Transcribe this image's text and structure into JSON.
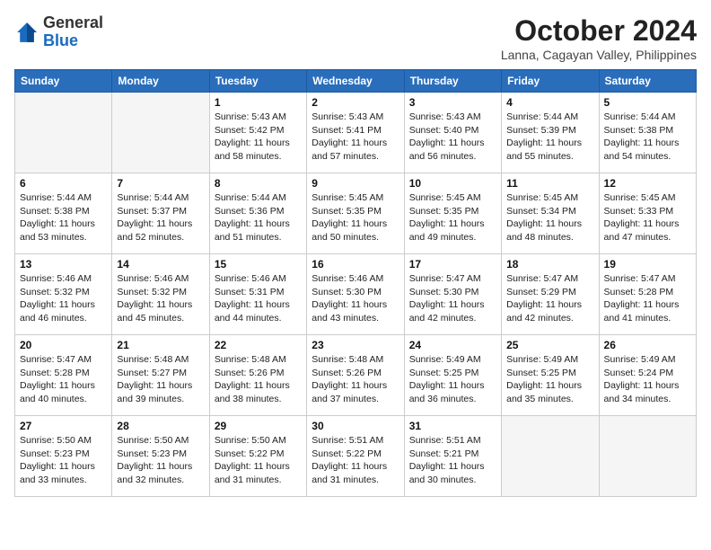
{
  "header": {
    "logo_general": "General",
    "logo_blue": "Blue",
    "month_title": "October 2024",
    "location": "Lanna, Cagayan Valley, Philippines"
  },
  "weekdays": [
    "Sunday",
    "Monday",
    "Tuesday",
    "Wednesday",
    "Thursday",
    "Friday",
    "Saturday"
  ],
  "weeks": [
    [
      {
        "day": "",
        "info": ""
      },
      {
        "day": "",
        "info": ""
      },
      {
        "day": "1",
        "info": "Sunrise: 5:43 AM\nSunset: 5:42 PM\nDaylight: 11 hours and 58 minutes."
      },
      {
        "day": "2",
        "info": "Sunrise: 5:43 AM\nSunset: 5:41 PM\nDaylight: 11 hours and 57 minutes."
      },
      {
        "day": "3",
        "info": "Sunrise: 5:43 AM\nSunset: 5:40 PM\nDaylight: 11 hours and 56 minutes."
      },
      {
        "day": "4",
        "info": "Sunrise: 5:44 AM\nSunset: 5:39 PM\nDaylight: 11 hours and 55 minutes."
      },
      {
        "day": "5",
        "info": "Sunrise: 5:44 AM\nSunset: 5:38 PM\nDaylight: 11 hours and 54 minutes."
      }
    ],
    [
      {
        "day": "6",
        "info": "Sunrise: 5:44 AM\nSunset: 5:38 PM\nDaylight: 11 hours and 53 minutes."
      },
      {
        "day": "7",
        "info": "Sunrise: 5:44 AM\nSunset: 5:37 PM\nDaylight: 11 hours and 52 minutes."
      },
      {
        "day": "8",
        "info": "Sunrise: 5:44 AM\nSunset: 5:36 PM\nDaylight: 11 hours and 51 minutes."
      },
      {
        "day": "9",
        "info": "Sunrise: 5:45 AM\nSunset: 5:35 PM\nDaylight: 11 hours and 50 minutes."
      },
      {
        "day": "10",
        "info": "Sunrise: 5:45 AM\nSunset: 5:35 PM\nDaylight: 11 hours and 49 minutes."
      },
      {
        "day": "11",
        "info": "Sunrise: 5:45 AM\nSunset: 5:34 PM\nDaylight: 11 hours and 48 minutes."
      },
      {
        "day": "12",
        "info": "Sunrise: 5:45 AM\nSunset: 5:33 PM\nDaylight: 11 hours and 47 minutes."
      }
    ],
    [
      {
        "day": "13",
        "info": "Sunrise: 5:46 AM\nSunset: 5:32 PM\nDaylight: 11 hours and 46 minutes."
      },
      {
        "day": "14",
        "info": "Sunrise: 5:46 AM\nSunset: 5:32 PM\nDaylight: 11 hours and 45 minutes."
      },
      {
        "day": "15",
        "info": "Sunrise: 5:46 AM\nSunset: 5:31 PM\nDaylight: 11 hours and 44 minutes."
      },
      {
        "day": "16",
        "info": "Sunrise: 5:46 AM\nSunset: 5:30 PM\nDaylight: 11 hours and 43 minutes."
      },
      {
        "day": "17",
        "info": "Sunrise: 5:47 AM\nSunset: 5:30 PM\nDaylight: 11 hours and 42 minutes."
      },
      {
        "day": "18",
        "info": "Sunrise: 5:47 AM\nSunset: 5:29 PM\nDaylight: 11 hours and 42 minutes."
      },
      {
        "day": "19",
        "info": "Sunrise: 5:47 AM\nSunset: 5:28 PM\nDaylight: 11 hours and 41 minutes."
      }
    ],
    [
      {
        "day": "20",
        "info": "Sunrise: 5:47 AM\nSunset: 5:28 PM\nDaylight: 11 hours and 40 minutes."
      },
      {
        "day": "21",
        "info": "Sunrise: 5:48 AM\nSunset: 5:27 PM\nDaylight: 11 hours and 39 minutes."
      },
      {
        "day": "22",
        "info": "Sunrise: 5:48 AM\nSunset: 5:26 PM\nDaylight: 11 hours and 38 minutes."
      },
      {
        "day": "23",
        "info": "Sunrise: 5:48 AM\nSunset: 5:26 PM\nDaylight: 11 hours and 37 minutes."
      },
      {
        "day": "24",
        "info": "Sunrise: 5:49 AM\nSunset: 5:25 PM\nDaylight: 11 hours and 36 minutes."
      },
      {
        "day": "25",
        "info": "Sunrise: 5:49 AM\nSunset: 5:25 PM\nDaylight: 11 hours and 35 minutes."
      },
      {
        "day": "26",
        "info": "Sunrise: 5:49 AM\nSunset: 5:24 PM\nDaylight: 11 hours and 34 minutes."
      }
    ],
    [
      {
        "day": "27",
        "info": "Sunrise: 5:50 AM\nSunset: 5:23 PM\nDaylight: 11 hours and 33 minutes."
      },
      {
        "day": "28",
        "info": "Sunrise: 5:50 AM\nSunset: 5:23 PM\nDaylight: 11 hours and 32 minutes."
      },
      {
        "day": "29",
        "info": "Sunrise: 5:50 AM\nSunset: 5:22 PM\nDaylight: 11 hours and 31 minutes."
      },
      {
        "day": "30",
        "info": "Sunrise: 5:51 AM\nSunset: 5:22 PM\nDaylight: 11 hours and 31 minutes."
      },
      {
        "day": "31",
        "info": "Sunrise: 5:51 AM\nSunset: 5:21 PM\nDaylight: 11 hours and 30 minutes."
      },
      {
        "day": "",
        "info": ""
      },
      {
        "day": "",
        "info": ""
      }
    ]
  ]
}
